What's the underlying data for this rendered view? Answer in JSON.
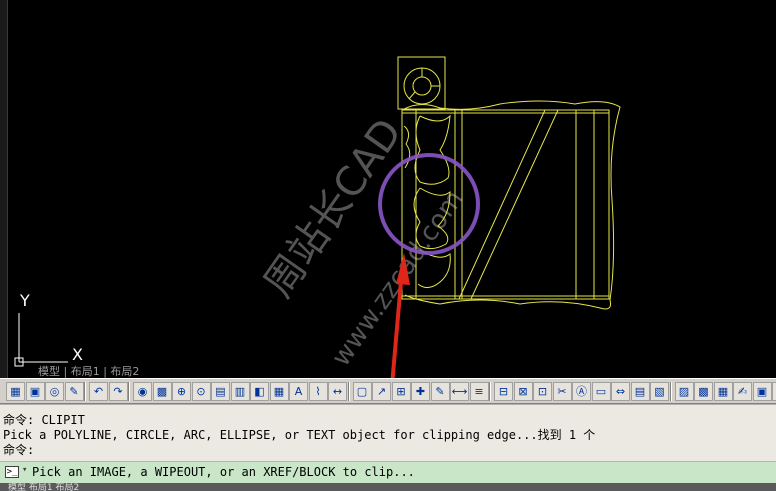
{
  "colors": {
    "viewport_bg": "#000000",
    "drawing": "#e6e64a",
    "clip_circle": "#8a55c8",
    "annotation_arrow": "#e0251b",
    "ucs": "#ffffff",
    "watermark": "#9a9a9a",
    "command_bg": "#ece9e2",
    "command_active_bg": "#c9e6c9"
  },
  "viewport": {
    "ucs_y_label": "Y",
    "ucs_x_label": "X",
    "watermark_line1": "周站长CAD",
    "watermark_line2": "www.zzcad.com"
  },
  "layout_tabs": {
    "visible_text": "模型 | 布局1 | 布局2"
  },
  "toolbar": {
    "icons": [
      "layer-states-icon",
      "save-icon",
      "print-preview-icon",
      "match-properties-icon",
      "undo-icon",
      "redo-icon",
      "circle-icon",
      "block-icon",
      "insert-icon",
      "point-icon",
      "hatch-icon",
      "gradient-icon",
      "region-icon",
      "table-icon",
      "multiline-text-icon",
      "polyline-icon",
      "dimension-icon",
      "select-window-icon",
      "leader-icon",
      "tolerance-icon",
      "center-mark-icon",
      "pen-icon",
      "measure-icon",
      "layers-icon",
      "xref-icon",
      "attach-icon",
      "external-ref-icon",
      "clip-icon",
      "text-style-icon",
      "table-style-icon",
      "dim-style-icon",
      "field-icon",
      "properties-icon",
      "design-center-icon",
      "tool-palettes-icon",
      "sheet-set-icon",
      "markup-icon",
      "calculator-icon",
      "help-icon"
    ]
  },
  "command": {
    "history": [
      "命令: CLIPIT",
      "Pick a POLYLINE, CIRCLE, ARC, ELLIPSE, or TEXT object for clipping edge...找到 1 个",
      "命令:"
    ],
    "active_prompt": "Pick an IMAGE, a WIPEOUT, or an XREF/BLOCK to clip..."
  },
  "status": {
    "visible_text": "模型  布局1  布局2"
  }
}
